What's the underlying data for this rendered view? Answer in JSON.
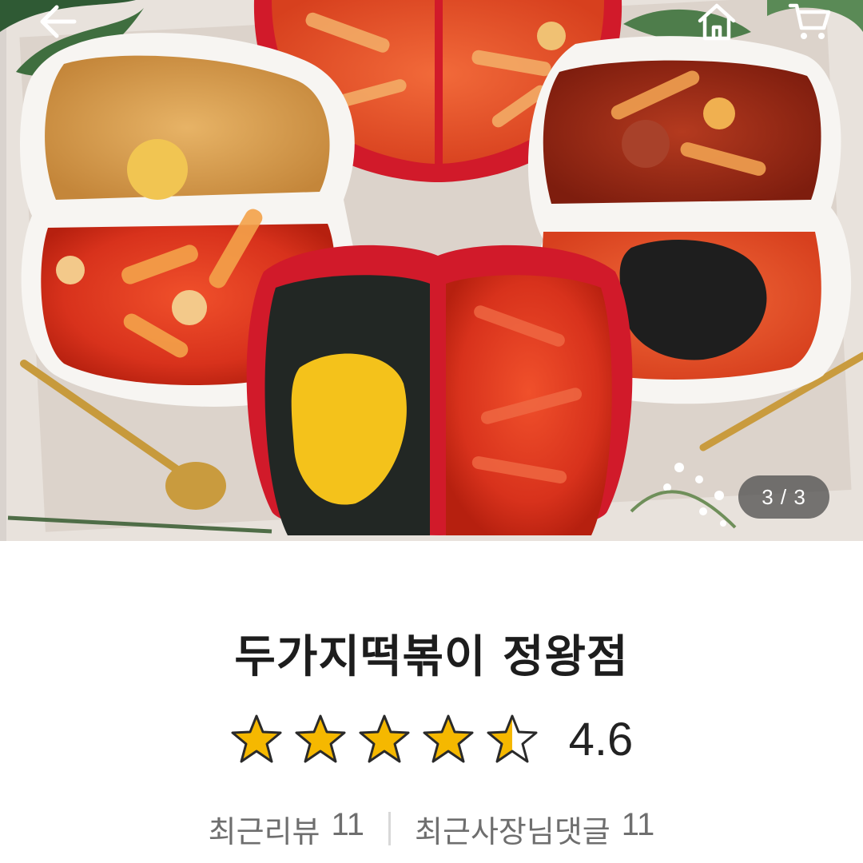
{
  "nav": {
    "back_icon": "arrow-left-icon",
    "home_icon": "home-icon",
    "cart_icon": "cart-icon"
  },
  "gallery": {
    "current": 3,
    "total": 3,
    "indicator": "3 / 3"
  },
  "store": {
    "name": "두가지떡볶이 정왕점",
    "rating": 4.6,
    "rating_label": "4.6",
    "stars": {
      "full": 4,
      "half": 1,
      "empty": 0
    },
    "star_color": "#f5b800"
  },
  "stats": {
    "recent_reviews_label": "최근리뷰",
    "recent_reviews_count": "11",
    "owner_replies_label": "최근사장님댓글",
    "owner_replies_count": "11"
  }
}
